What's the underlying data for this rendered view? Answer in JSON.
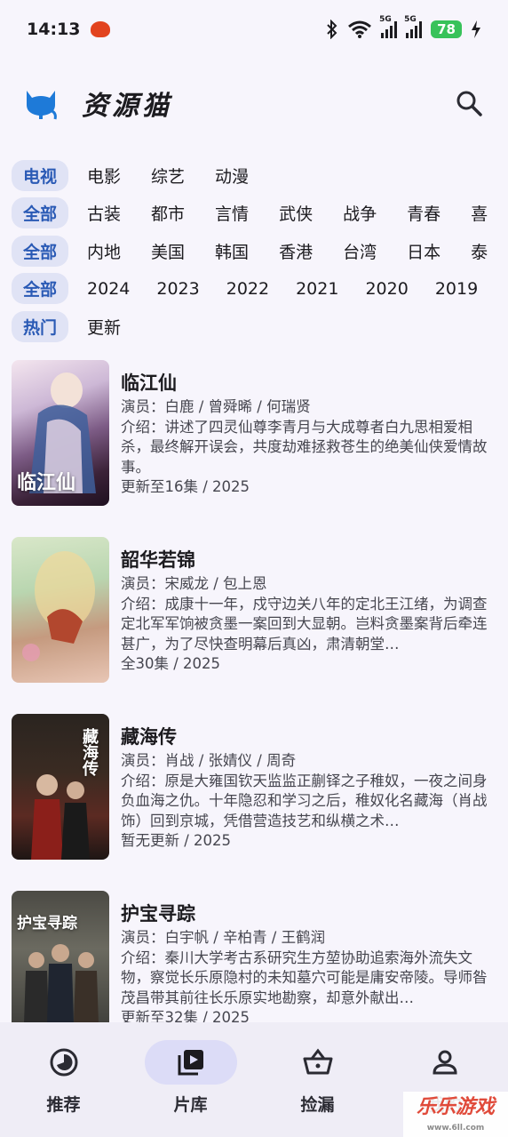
{
  "status_bar": {
    "time": "14:13",
    "network_1": "5G",
    "network_2": "5G",
    "battery": "78"
  },
  "header": {
    "app_name": "资源猫"
  },
  "filters": {
    "type_row": [
      "电视",
      "电影",
      "综艺",
      "动漫"
    ],
    "genre_row": [
      "全部",
      "古装",
      "都市",
      "言情",
      "武侠",
      "战争",
      "青春",
      "喜"
    ],
    "region_row": [
      "全部",
      "内地",
      "美国",
      "韩国",
      "香港",
      "台湾",
      "日本",
      "泰"
    ],
    "year_row": [
      "全部",
      "2024",
      "2023",
      "2022",
      "2021",
      "2020",
      "2019"
    ],
    "sort_row": [
      "热门",
      "更新"
    ]
  },
  "items": [
    {
      "title": "临江仙",
      "poster_text": "临江仙",
      "actors": "演员：白鹿 / 曾舜晞 / 何瑞贤",
      "desc": "介绍：讲述了四灵仙尊李青月与大成尊者白九思相爱相杀，最终解开误会，共度劫难拯救苍生的绝美仙侠爱情故事。",
      "meta": "更新至16集 / 2025"
    },
    {
      "title": "韶华若锦",
      "poster_text": "",
      "actors": "演员：宋威龙 / 包上恩",
      "desc": "介绍：成康十一年，戍守边关八年的定北王江绪，为调查定北军军饷被贪墨一案回到大显朝。岂料贪墨案背后牵连甚广，为了尽快查明幕后真凶，肃清朝堂…",
      "meta": "全30集 / 2025"
    },
    {
      "title": "藏海传",
      "poster_text": "藏海传",
      "actors": "演员：肖战 / 张婧仪 / 周奇",
      "desc": "介绍：原是大雍国钦天监监正蒯铎之子稚奴，一夜之间身负血海之仇。十年隐忍和学习之后，稚奴化名藏海（肖战 饰）回到京城，凭借营造技艺和纵横之术…",
      "meta": "暂无更新 / 2025"
    },
    {
      "title": "护宝寻踪",
      "poster_text": "护宝寻踪",
      "actors": "演员：白宇帆 / 辛柏青 / 王鹤润",
      "desc": "介绍：秦川大学考古系研究生方堃协助追索海外流失文物，察觉长乐原隐村的未知墓穴可能是庸安帝陵。导师昝茂昌带其前往长乐原实地勘察，却意外献出…",
      "meta": "更新至32集 / 2025"
    }
  ],
  "bottom_nav": {
    "recommend": "推荐",
    "library": "片库",
    "bargain": "捡漏",
    "mine": "我的"
  },
  "watermark": {
    "text": "乐乐游戏",
    "url": "www.6ll.com"
  },
  "colors": {
    "accent": "#2a5ab5",
    "chip_bg": "#e0e3f5",
    "nav_bg": "#efedf6",
    "nav_active": "#dcdcf7"
  }
}
